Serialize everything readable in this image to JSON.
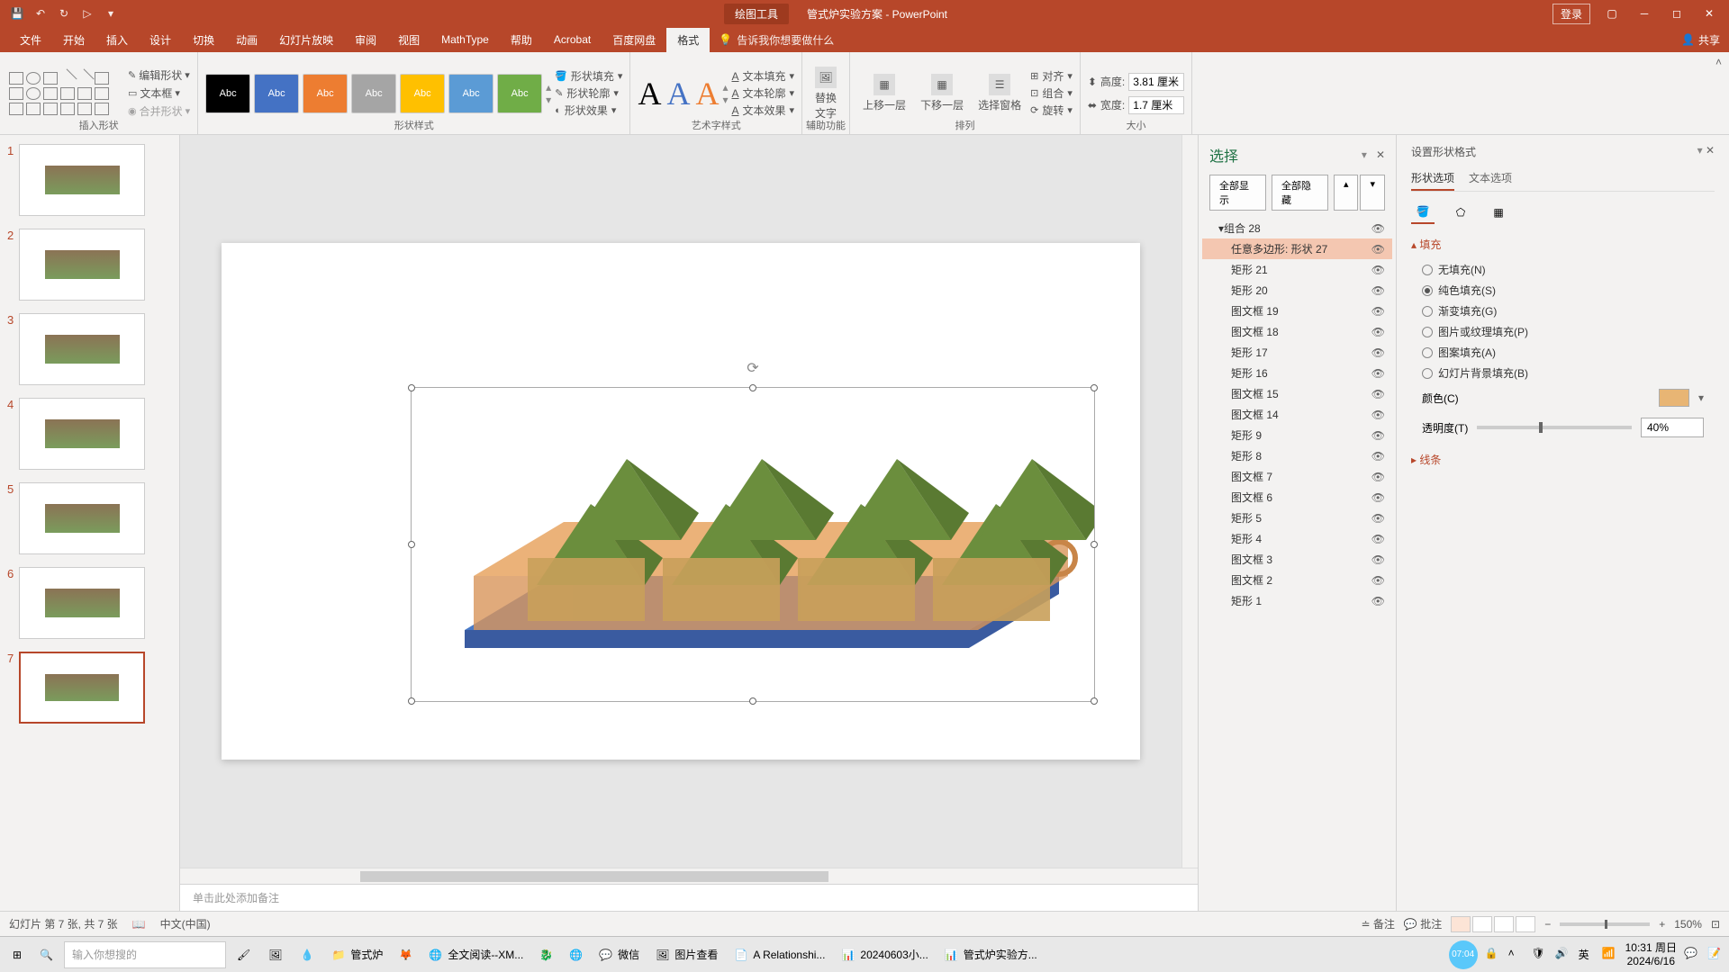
{
  "titlebar": {
    "tool_context": "绘图工具",
    "doc_title": "管式炉实验方案 - PowerPoint",
    "login": "登录"
  },
  "tabs": {
    "file": "文件",
    "home": "开始",
    "insert": "插入",
    "design": "设计",
    "transitions": "切换",
    "animations": "动画",
    "slideshow": "幻灯片放映",
    "review": "审阅",
    "view": "视图",
    "mathtype": "MathType",
    "help": "帮助",
    "acrobat": "Acrobat",
    "baidu": "百度网盘",
    "format": "格式",
    "tell_me": "告诉我你想要做什么",
    "share": "共享"
  },
  "ribbon": {
    "g_insert": "插入形状",
    "g_styles": "形状样式",
    "g_wordart": "艺术字样式",
    "g_acc": "辅助功能",
    "g_arr": "排列",
    "g_size": "大小",
    "edit_shape": "编辑形状",
    "text_box": "文本框",
    "merge": "合并形状",
    "shape_fill": "形状填充",
    "shape_outline": "形状轮廓",
    "shape_effects": "形状效果",
    "text_fill": "文本填充",
    "text_outline": "文本轮廓",
    "text_effects": "文本效果",
    "alt_text": "替换\n文字",
    "bring_fwd": "上移一层",
    "send_back": "下移一层",
    "sel_pane": "选择窗格",
    "align": "对齐",
    "group": "组合",
    "rotate": "旋转",
    "height": "高度:",
    "width": "宽度:",
    "h_val": "3.81 厘米",
    "w_val": "1.7 厘米",
    "style_label": "Abc"
  },
  "thumbs": {
    "count": 7,
    "active": 7
  },
  "notes_placeholder": "单击此处添加备注",
  "selection": {
    "title": "选择",
    "show_all": "全部显示",
    "hide_all": "全部隐藏",
    "items": [
      {
        "label": "组合 28",
        "lvl": 1
      },
      {
        "label": "任意多边形: 形状 27",
        "lvl": 2,
        "selected": true
      },
      {
        "label": "矩形 21",
        "lvl": 2
      },
      {
        "label": "矩形 20",
        "lvl": 2
      },
      {
        "label": "图文框 19",
        "lvl": 2
      },
      {
        "label": "图文框 18",
        "lvl": 2
      },
      {
        "label": "矩形 17",
        "lvl": 2
      },
      {
        "label": "矩形 16",
        "lvl": 2
      },
      {
        "label": "图文框 15",
        "lvl": 2
      },
      {
        "label": "图文框 14",
        "lvl": 2
      },
      {
        "label": "矩形 9",
        "lvl": 2
      },
      {
        "label": "矩形 8",
        "lvl": 2
      },
      {
        "label": "图文框 7",
        "lvl": 2
      },
      {
        "label": "图文框 6",
        "lvl": 2
      },
      {
        "label": "矩形 5",
        "lvl": 2
      },
      {
        "label": "矩形 4",
        "lvl": 2
      },
      {
        "label": "图文框 3",
        "lvl": 2
      },
      {
        "label": "图文框 2",
        "lvl": 2
      },
      {
        "label": "矩形 1",
        "lvl": 2
      }
    ]
  },
  "format_pane": {
    "title": "设置形状格式",
    "tab_shape": "形状选项",
    "tab_text": "文本选项",
    "sec_fill": "填充",
    "sec_line": "线条",
    "no_fill": "无填充(N)",
    "solid": "纯色填充(S)",
    "gradient": "渐变填充(G)",
    "picture": "图片或纹理填充(P)",
    "pattern": "图案填充(A)",
    "slide_bg": "幻灯片背景填充(B)",
    "color": "颜色(C)",
    "transparency": "透明度(T)",
    "trans_val": "40%"
  },
  "status": {
    "slide": "幻灯片 第 7 张, 共 7 张",
    "lang": "中文(中国)",
    "notes": "备注",
    "comments": "批注",
    "zoom": "150%"
  },
  "taskbar": {
    "search_placeholder": "输入你想搜的",
    "apps": [
      {
        "label": "管式炉",
        "ico": "📁"
      },
      {
        "label": "",
        "ico": "🦊"
      },
      {
        "label": "全文阅读--XM...",
        "ico": "🌐"
      },
      {
        "label": "",
        "ico": "🐉"
      },
      {
        "label": "",
        "ico": "🌐"
      },
      {
        "label": "微信",
        "ico": "💬"
      },
      {
        "label": "图片查看",
        "ico": "🖼"
      },
      {
        "label": "A Relationshi...",
        "ico": "📄"
      },
      {
        "label": "20240603小...",
        "ico": "📊"
      },
      {
        "label": "管式炉实验方...",
        "ico": "📊"
      }
    ],
    "time": "10:31 周日",
    "date": "2024/6/16"
  }
}
